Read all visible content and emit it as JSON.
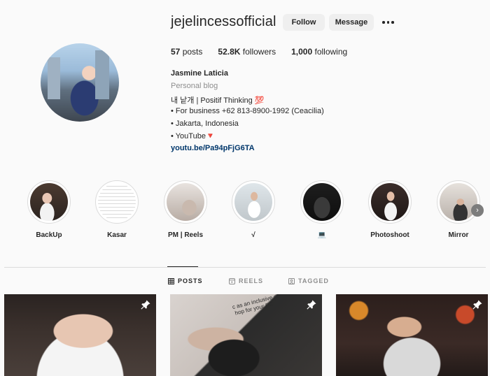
{
  "profile": {
    "username": "jejelincessofficial",
    "follow_label": "Follow",
    "message_label": "Message",
    "posts_count": "57",
    "posts_label": "posts",
    "followers_count": "52.8K",
    "followers_label": "followers",
    "following_count": "1,000",
    "following_label": "following",
    "full_name": "Jasmine Laticia",
    "category": "Personal blog",
    "bio_lines": [
      "내 낱개 | Positif Thinking 💯",
      "• For business +62 813-8900-1992 (Ceacilia)",
      "• Jakarta, Indonesia",
      "• YouTube🔻"
    ],
    "link": "youtu.be/Pa94pFjG6TA"
  },
  "highlights": [
    {
      "label": "BackUp"
    },
    {
      "label": "Kasar"
    },
    {
      "label": "PM | Reels"
    },
    {
      "label": "√"
    },
    {
      "label": "💻"
    },
    {
      "label": "Photoshoot"
    },
    {
      "label": "Mirror"
    }
  ],
  "tabs": [
    {
      "label": "POSTS",
      "icon": "grid-icon",
      "active": true
    },
    {
      "label": "REELS",
      "icon": "reels-icon",
      "active": false
    },
    {
      "label": "TAGGED",
      "icon": "tagged-icon",
      "active": false
    }
  ],
  "posts": [
    {
      "pinned": true
    },
    {
      "pinned": true,
      "overlay_text": "c as an inclusive or",
      "overlay_text2": "hop for your PC"
    },
    {
      "pinned": true
    }
  ],
  "colors": {
    "background": "#fafafa",
    "button_bg": "#efefef",
    "text": "#262626",
    "muted": "#8e8e8e",
    "link": "#00376b",
    "divider": "#dbdbdb"
  }
}
